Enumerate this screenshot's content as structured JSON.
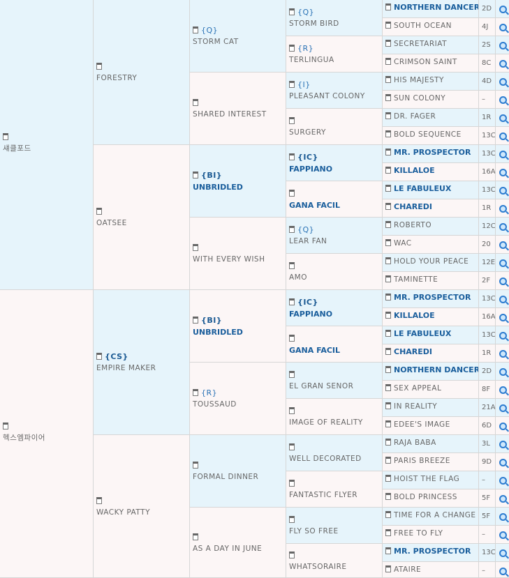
{
  "horses": {
    "g1": [
      {
        "name": "섀클포드",
        "code": "",
        "bold": false
      },
      {
        "name": "헥스엠파이어",
        "code": "",
        "bold": false
      }
    ],
    "g2": [
      {
        "name": "FORESTRY",
        "code": "",
        "bold": false
      },
      {
        "name": "OATSEE",
        "code": "",
        "bold": false
      },
      {
        "name": "EMPIRE MAKER",
        "code": "{CS}",
        "bold": false,
        "code_bold": true
      },
      {
        "name": "WACKY PATTY",
        "code": "",
        "bold": false
      }
    ],
    "g3": [
      {
        "name": "STORM CAT",
        "code": "{Q}",
        "bold": false
      },
      {
        "name": "SHARED INTEREST",
        "code": "",
        "bold": false
      },
      {
        "name": "UNBRIDLED",
        "code": "{BI}",
        "bold": true
      },
      {
        "name": "WITH EVERY WISH",
        "code": "",
        "bold": false
      },
      {
        "name": "UNBRIDLED",
        "code": "{BI}",
        "bold": true
      },
      {
        "name": "TOUSSAUD",
        "code": "{R}",
        "bold": false
      },
      {
        "name": "FORMAL DINNER",
        "code": "",
        "bold": false
      },
      {
        "name": "AS A DAY IN JUNE",
        "code": "",
        "bold": false
      }
    ],
    "g4": [
      {
        "name": "STORM BIRD",
        "code": "{Q}",
        "bold": false
      },
      {
        "name": "TERLINGUA",
        "code": "{R}",
        "bold": false
      },
      {
        "name": "PLEASANT COLONY",
        "code": "{I}",
        "bold": false
      },
      {
        "name": "SURGERY",
        "code": "",
        "bold": false
      },
      {
        "name": "FAPPIANO",
        "code": "{IC}",
        "bold": true
      },
      {
        "name": "GANA FACIL",
        "code": "",
        "bold": true
      },
      {
        "name": "LEAR FAN",
        "code": "{Q}",
        "bold": false
      },
      {
        "name": "AMO",
        "code": "",
        "bold": false
      },
      {
        "name": "FAPPIANO",
        "code": "{IC}",
        "bold": true
      },
      {
        "name": "GANA FACIL",
        "code": "",
        "bold": true
      },
      {
        "name": "EL GRAN SENOR",
        "code": "",
        "bold": false
      },
      {
        "name": "IMAGE OF REALITY",
        "code": "",
        "bold": false
      },
      {
        "name": "WELL DECORATED",
        "code": "",
        "bold": false
      },
      {
        "name": "FANTASTIC FLYER",
        "code": "",
        "bold": false
      },
      {
        "name": "FLY SO FREE",
        "code": "",
        "bold": false
      },
      {
        "name": "WHATSORAIRE",
        "code": "",
        "bold": false
      }
    ],
    "g5": [
      {
        "name": "NORTHERN DANCER",
        "num": "2D",
        "bold": true
      },
      {
        "name": "SOUTH OCEAN",
        "num": "4J",
        "bold": false
      },
      {
        "name": "SECRETARIAT",
        "num": "2S",
        "bold": false
      },
      {
        "name": "CRIMSON SAINT",
        "num": "8C",
        "bold": false
      },
      {
        "name": "HIS MAJESTY",
        "num": "4D",
        "bold": false
      },
      {
        "name": "SUN COLONY",
        "num": "–",
        "bold": false
      },
      {
        "name": "DR. FAGER",
        "num": "1R",
        "bold": false
      },
      {
        "name": "BOLD SEQUENCE",
        "num": "13C",
        "bold": false
      },
      {
        "name": "MR. PROSPECTOR",
        "num": "13C",
        "bold": true
      },
      {
        "name": "KILLALOE",
        "num": "16A",
        "bold": true
      },
      {
        "name": "LE FABULEUX",
        "num": "13C",
        "bold": true
      },
      {
        "name": "CHAREDI",
        "num": "1R",
        "bold": true
      },
      {
        "name": "ROBERTO",
        "num": "12C",
        "bold": false
      },
      {
        "name": "WAC",
        "num": "20",
        "bold": false
      },
      {
        "name": "HOLD YOUR PEACE",
        "num": "12E",
        "bold": false
      },
      {
        "name": "TAMINETTE",
        "num": "2F",
        "bold": false
      },
      {
        "name": "MR. PROSPECTOR",
        "num": "13C",
        "bold": true
      },
      {
        "name": "KILLALOE",
        "num": "16A",
        "bold": true
      },
      {
        "name": "LE FABULEUX",
        "num": "13C",
        "bold": true
      },
      {
        "name": "CHAREDI",
        "num": "1R",
        "bold": true
      },
      {
        "name": "NORTHERN DANCER",
        "num": "2D",
        "bold": true
      },
      {
        "name": "SEX APPEAL",
        "num": "8F",
        "bold": false
      },
      {
        "name": "IN REALITY",
        "num": "21A",
        "bold": false
      },
      {
        "name": "EDEE'S IMAGE",
        "num": "6D",
        "bold": false
      },
      {
        "name": "RAJA BABA",
        "num": "3L",
        "bold": false
      },
      {
        "name": "PARIS BREEZE",
        "num": "9D",
        "bold": false
      },
      {
        "name": "HOIST THE FLAG",
        "num": "–",
        "bold": false
      },
      {
        "name": "BOLD PRINCESS",
        "num": "5F",
        "bold": false
      },
      {
        "name": "TIME FOR A CHANGE",
        "num": "5F",
        "bold": false
      },
      {
        "name": "FREE TO FLY",
        "num": "–",
        "bold": false
      },
      {
        "name": "MR. PROSPECTOR",
        "num": "13C",
        "bold": true
      },
      {
        "name": "ATAIRE",
        "num": "–",
        "bold": false
      }
    ]
  },
  "icons": {
    "document": "document-icon",
    "search": "search-icon"
  },
  "colors": {
    "blue_cell": "#e6f4fb",
    "pink_cell": "#fcf6f6",
    "bold_name": "#1a5e9c",
    "code": "#2a72b5"
  }
}
